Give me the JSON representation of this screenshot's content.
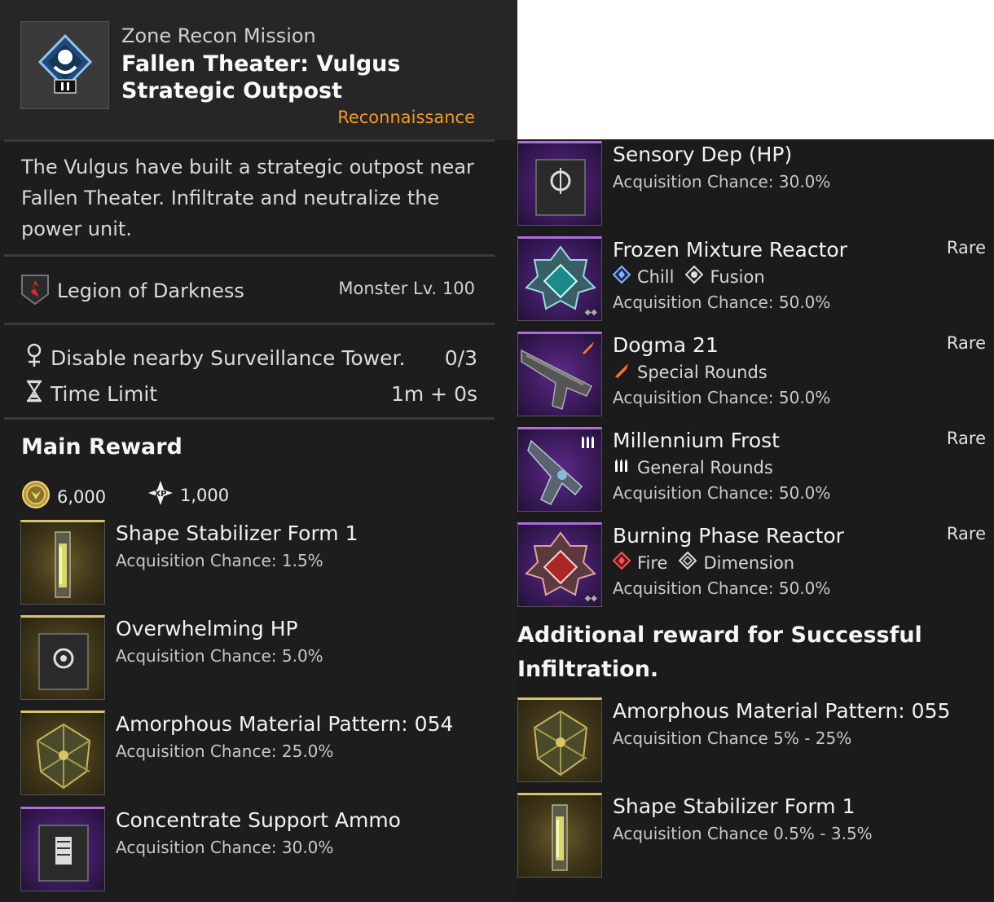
{
  "mission": {
    "type": "Zone Recon Mission",
    "title": "Fallen Theater: Vulgus Strategic Outpost",
    "category": "Reconnaissance",
    "description": "The Vulgus have built a strategic outpost near Fallen Theater. Infiltrate and neutralize the power unit.",
    "faction": "Legion of Darkness",
    "monster_level": "Monster Lv. 100",
    "objectives": [
      {
        "icon": "location-pin-icon",
        "text": "Disable nearby Surveillance Tower.",
        "value": "0/3"
      },
      {
        "icon": "hourglass-icon",
        "text": "Time Limit",
        "value": "1m + 0s"
      }
    ]
  },
  "main_reward": {
    "title": "Main Reward",
    "gold": "6,000",
    "xp": "1,000",
    "items": [
      {
        "name": "Shape Stabilizer Form 1",
        "chance": "Acquisition Chance: 1.5%",
        "rarity_color": "#d8c36a"
      },
      {
        "name": "Overwhelming HP",
        "chance": "Acquisition Chance: 5.0%",
        "rarity_color": "#d8c36a"
      },
      {
        "name": "Amorphous Material Pattern: 054",
        "chance": "Acquisition Chance: 25.0%",
        "rarity_color": "#d8c36a"
      },
      {
        "name": "Concentrate Support Ammo",
        "chance": "Acquisition Chance: 30.0%",
        "rarity_color": "#b06de0"
      }
    ],
    "items_right": [
      {
        "name": "Sensory Dep (HP)",
        "chance": "Acquisition Chance: 30.0%"
      },
      {
        "name": "Frozen Mixture Reactor",
        "rarity": "Rare",
        "tags": [
          "Chill",
          "Fusion"
        ],
        "chance": "Acquisition Chance: 50.0%"
      },
      {
        "name": "Dogma 21",
        "rarity": "Rare",
        "tags": [
          "Special Rounds"
        ],
        "chance": "Acquisition Chance: 50.0%"
      },
      {
        "name": "Millennium Frost",
        "rarity": "Rare",
        "tags": [
          "General Rounds"
        ],
        "chance": "Acquisition Chance: 50.0%"
      },
      {
        "name": "Burning Phase Reactor",
        "rarity": "Rare",
        "tags": [
          "Fire",
          "Dimension"
        ],
        "chance": "Acquisition Chance: 50.0%"
      }
    ]
  },
  "additional_reward": {
    "title": "Additional reward for Successful Infiltration.",
    "items": [
      {
        "name": "Amorphous Material Pattern: 055",
        "chance": "Acquisition Chance 5% - 25%"
      },
      {
        "name": "Shape Stabilizer Form 1",
        "chance": "Acquisition Chance 0.5% - 3.5%"
      }
    ]
  },
  "colors": {
    "accent_orange": "#f09a2a",
    "gold_tier": "#d8c36a",
    "purple_tier": "#b06de0"
  }
}
